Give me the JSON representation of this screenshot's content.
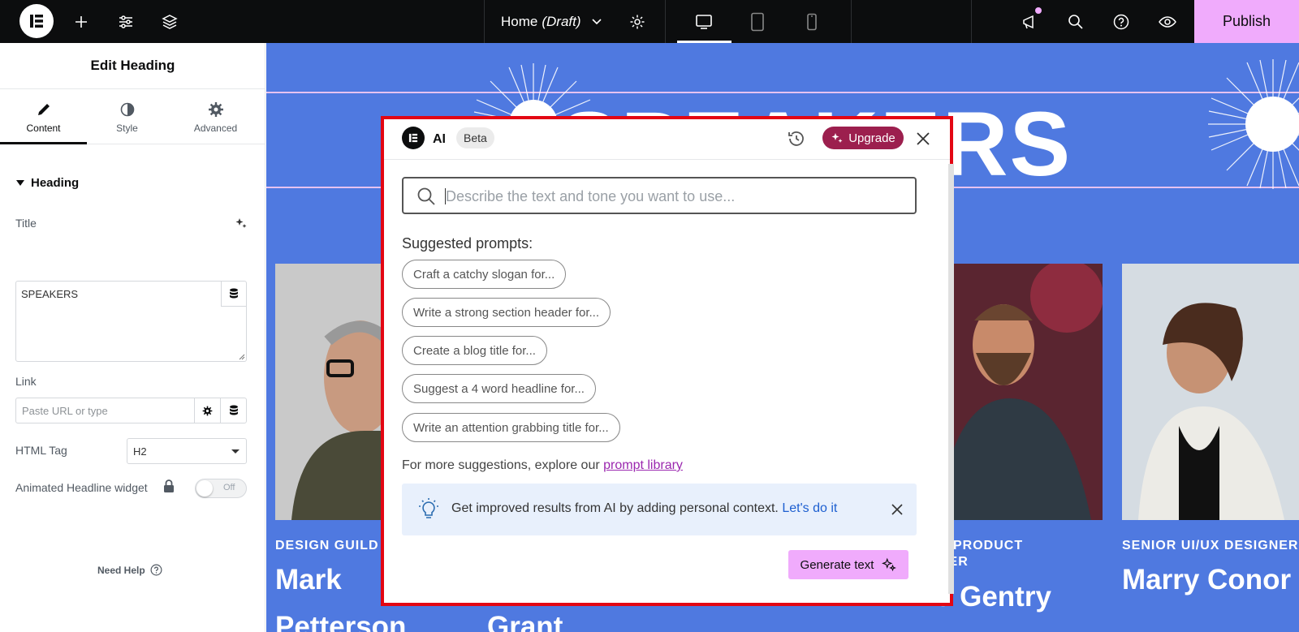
{
  "topbar": {
    "page_title": "Home",
    "page_status": "(Draft)",
    "publish_label": "Publish"
  },
  "panel": {
    "title": "Edit Heading",
    "tabs": [
      {
        "label": "Content"
      },
      {
        "label": "Style"
      },
      {
        "label": "Advanced"
      }
    ],
    "section": "Heading",
    "title_label": "Title",
    "title_value": "SPEAKERS",
    "link_label": "Link",
    "link_placeholder": "Paste URL or type",
    "html_tag_label": "HTML Tag",
    "html_tag_value": "H2",
    "animated_label": "Animated Headline widget",
    "toggle_state": "Off",
    "need_help": "Need Help"
  },
  "canvas": {
    "heading": "SPEAKERS",
    "cards": [
      {
        "role": "DESIGN GUILD",
        "name_line1": "Mark",
        "name_line2": "Petterson"
      },
      {
        "role": "",
        "name_line1": "",
        "name_line2": "Grant"
      },
      {
        "role": "R PRODUCT",
        "role_line2": "NER",
        "name_line1": "o Gentry"
      },
      {
        "role": "SENIOR UI/UX DESIGNER",
        "name_line1": "Marry Conor"
      }
    ]
  },
  "ai_dialog": {
    "title": "AI",
    "badge": "Beta",
    "upgrade_label": "Upgrade",
    "search_placeholder": "Describe the text and tone you want to use...",
    "suggested_title": "Suggested prompts:",
    "prompts": [
      "Craft a catchy slogan for...",
      "Write a strong section header for...",
      "Create a blog title for...",
      "Suggest a 4 word headline for...",
      "Write an attention grabbing title for..."
    ],
    "more_text": "For more suggestions, explore our",
    "more_link": "prompt library",
    "context_text": "Get improved results from AI by adding personal context.",
    "context_cta": "Let's do it",
    "generate_label": "Generate text"
  },
  "colors": {
    "publish": "#f0abfc",
    "canvas_bg": "#4f79e0",
    "upgrade": "#9c1f4e",
    "highlight_border": "#e30613",
    "link": "#9b27af"
  }
}
